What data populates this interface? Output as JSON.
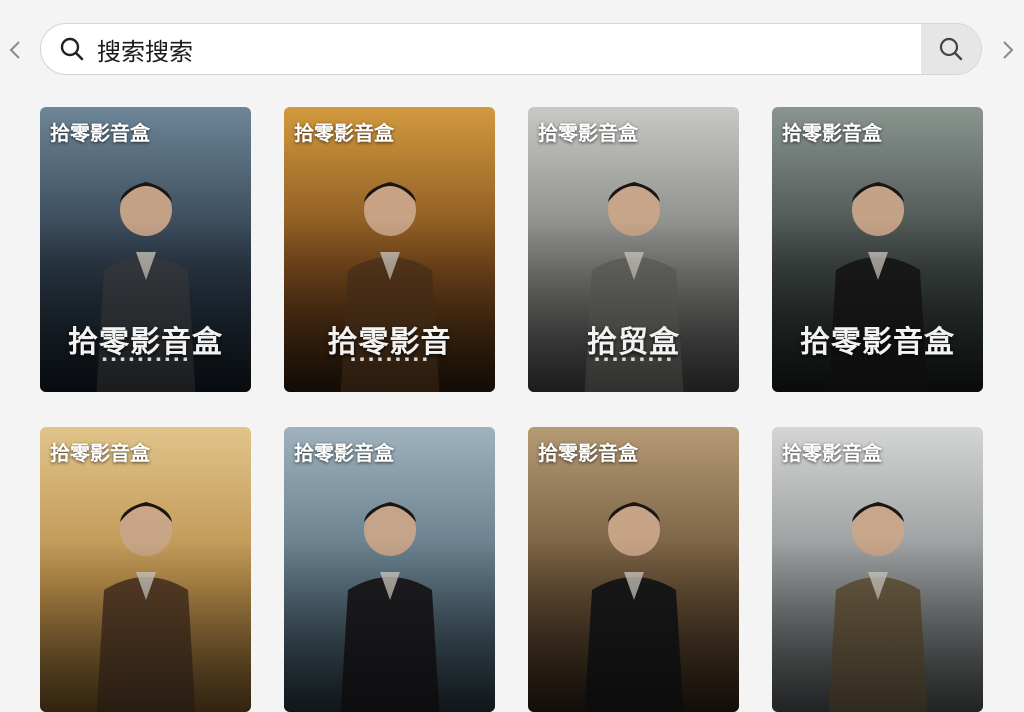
{
  "search": {
    "value": "搜索搜索",
    "placeholder": "搜索"
  },
  "icons": {
    "back": "chevron-left-icon",
    "forward": "chevron-right-icon",
    "search": "search-icon"
  },
  "cards": [
    {
      "badge": "拾零影音盒",
      "title": "拾零影音盒",
      "subtitle": "▪ ▪ ▪ ▪ ▪ ▪ ▪ ▪ ▪ ▪",
      "bg": [
        "#6d8698",
        "#2c3a48",
        "#121a22"
      ],
      "accent": "#3a3f44"
    },
    {
      "badge": "拾零影音盒",
      "title": "拾零影音",
      "subtitle": "▪ ▪ ▪ ▪ ▪ ▪ ▪ ▪ ▪",
      "bg": [
        "#d29a3e",
        "#7a4a1c",
        "#2b1a0c"
      ],
      "accent": "#5b3a1d"
    },
    {
      "badge": "拾零影音盒",
      "title": "拾贸盒",
      "subtitle": "▪ ▪ ▪ ▪ ▪ ▪ ▪ ▪ ▪",
      "bg": [
        "#c8c8c4",
        "#7d7f7c",
        "#3e403e"
      ],
      "accent": "#6b6b66"
    },
    {
      "badge": "拾零影音盒",
      "title": "拾零影音盒",
      "subtitle": "",
      "bg": [
        "#8b9590",
        "#3d4543",
        "#151a19"
      ],
      "accent": "#1c1c1c"
    },
    {
      "badge": "拾零影音盒",
      "title": "",
      "subtitle": "",
      "bg": [
        "#e1c48a",
        "#b88e4a",
        "#6d4f26"
      ],
      "accent": "#5a4028"
    },
    {
      "badge": "拾零影音盒",
      "title": "",
      "subtitle": "",
      "bg": [
        "#9fb2bd",
        "#5b7280",
        "#24323b"
      ],
      "accent": "#1e1e22"
    },
    {
      "badge": "拾零影音盒",
      "title": "",
      "subtitle": "",
      "bg": [
        "#b59b74",
        "#6a5238",
        "#2a1e14"
      ],
      "accent": "#1a1a1a"
    },
    {
      "badge": "拾零影音盒",
      "title": "",
      "subtitle": "",
      "bg": [
        "#d4d6d4",
        "#8c9091",
        "#4a4e4f"
      ],
      "accent": "#6b5c43"
    }
  ]
}
